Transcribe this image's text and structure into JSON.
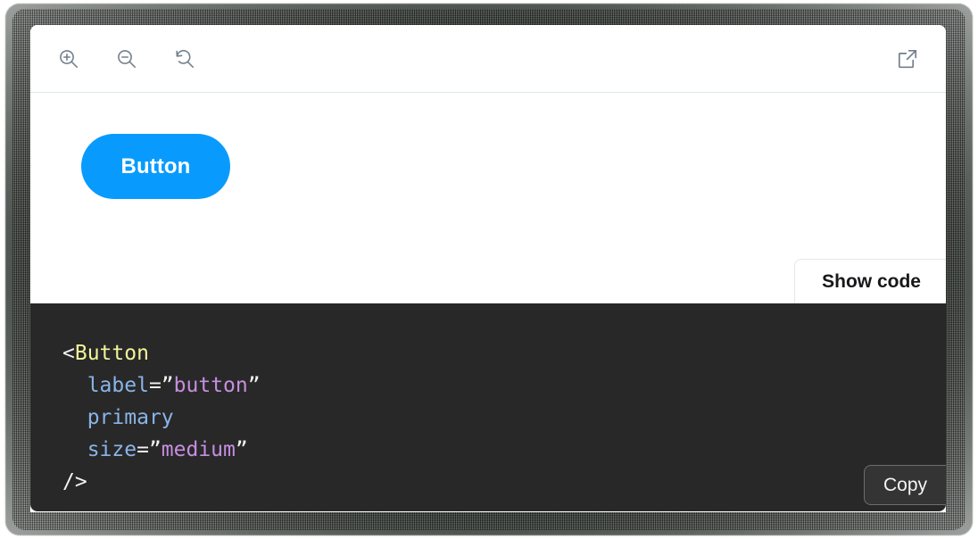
{
  "toolbar": {
    "zoom_in": {
      "icon": "zoom-in-icon",
      "title": "Zoom in"
    },
    "zoom_out": {
      "icon": "zoom-out-icon",
      "title": "Zoom out"
    },
    "zoom_reset": {
      "icon": "zoom-reset-icon",
      "title": "Reset zoom"
    },
    "open_external": {
      "icon": "open-external-icon",
      "title": "Open canvas in new tab"
    },
    "divider_color": "#dde5ec"
  },
  "preview": {
    "background": "#ffffff",
    "component": {
      "type": "button",
      "label": "Button",
      "variant": "primary",
      "size": "medium",
      "accent_color": "#089bfd",
      "text_color": "#ffffff",
      "shape": "pill"
    },
    "show_code_label": "Show code"
  },
  "code_panel": {
    "background": "#282828",
    "copy_label": "Copy",
    "language": "jsx",
    "raw": "<Button\n  label=”button”\n  primary\n  size=”medium”\n/>",
    "lines": [
      {
        "indent": 0,
        "tokens": [
          {
            "text": "<",
            "type": "punct"
          },
          {
            "text": "Button",
            "type": "tag"
          }
        ]
      },
      {
        "indent": 1,
        "tokens": [
          {
            "text": "label",
            "type": "attr"
          },
          {
            "text": "=”",
            "type": "punct"
          },
          {
            "text": "button",
            "type": "string"
          },
          {
            "text": "”",
            "type": "punct"
          }
        ]
      },
      {
        "indent": 1,
        "tokens": [
          {
            "text": "primary",
            "type": "attr"
          }
        ]
      },
      {
        "indent": 1,
        "tokens": [
          {
            "text": "size",
            "type": "attr"
          },
          {
            "text": "=”",
            "type": "punct"
          },
          {
            "text": "medium",
            "type": "string"
          },
          {
            "text": "”",
            "type": "punct"
          }
        ]
      },
      {
        "indent": 0,
        "tokens": [
          {
            "text": "/>",
            "type": "punct"
          }
        ]
      }
    ],
    "token_colors": {
      "punct": "#f2f2f2",
      "tag": "#f3f39a",
      "attr": "#8ab4e8",
      "string": "#c58fe0"
    }
  }
}
